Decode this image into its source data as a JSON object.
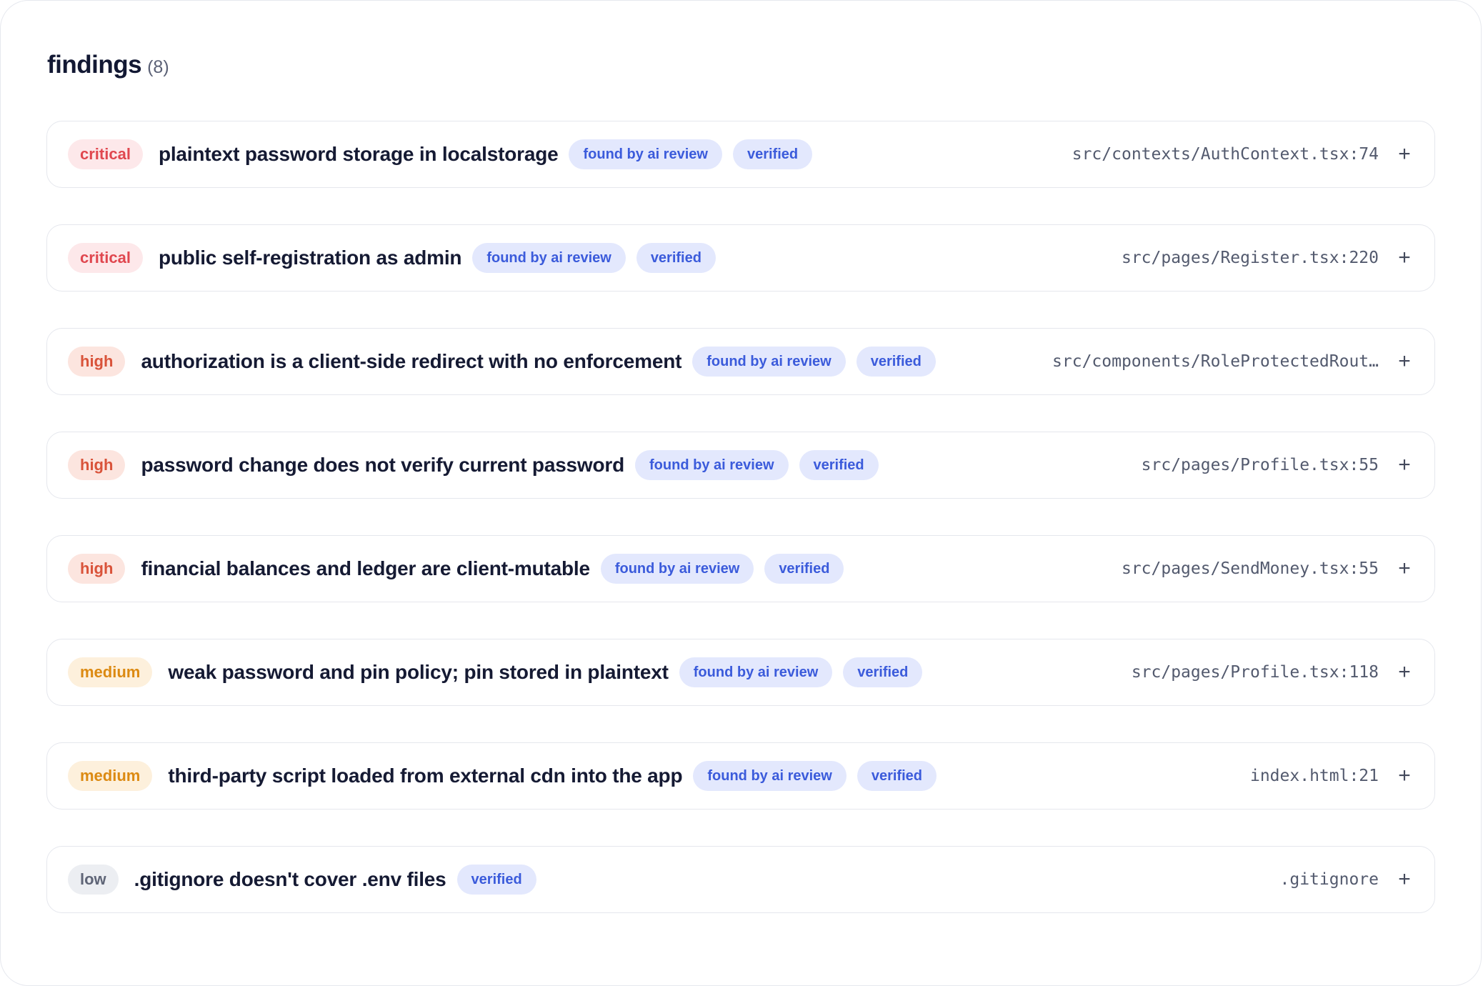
{
  "header": {
    "title": "findings",
    "count": "(8)"
  },
  "labels": {
    "found_by": "found by ai review",
    "verified": "verified"
  },
  "colors": {
    "critical": "#e0474f",
    "high": "#d9533a",
    "medium": "#dc8a12",
    "low": "#5f6577",
    "tag": "#3b5bdb"
  },
  "findings": [
    {
      "severity": "critical",
      "title": "plaintext password storage in localstorage",
      "found_by_ai": true,
      "verified": true,
      "location": "src/contexts/AuthContext.tsx:74",
      "expand_icon": "plus-icon"
    },
    {
      "severity": "critical",
      "title": "public self-registration as admin",
      "found_by_ai": true,
      "verified": true,
      "location": "src/pages/Register.tsx:220",
      "expand_icon": "plus-icon"
    },
    {
      "severity": "high",
      "title": "authorization is a client-side redirect with no enforcement",
      "found_by_ai": true,
      "verified": true,
      "location": "src/components/RoleProtectedRout…",
      "expand_icon": "plus-icon"
    },
    {
      "severity": "high",
      "title": "password change does not verify current password",
      "found_by_ai": true,
      "verified": true,
      "location": "src/pages/Profile.tsx:55",
      "expand_icon": "plus-icon"
    },
    {
      "severity": "high",
      "title": "financial balances and ledger are client-mutable",
      "found_by_ai": true,
      "verified": true,
      "location": "src/pages/SendMoney.tsx:55",
      "expand_icon": "plus-icon"
    },
    {
      "severity": "medium",
      "title": "weak password and pin policy; pin stored in plaintext",
      "found_by_ai": true,
      "verified": true,
      "location": "src/pages/Profile.tsx:118",
      "expand_icon": "plus-icon"
    },
    {
      "severity": "medium",
      "title": "third-party script loaded from external cdn into the app",
      "found_by_ai": true,
      "verified": true,
      "location": "index.html:21",
      "expand_icon": "plus-icon"
    },
    {
      "severity": "low",
      "title": ".gitignore doesn't cover .env files",
      "found_by_ai": false,
      "verified": true,
      "location": ".gitignore",
      "expand_icon": "plus-icon"
    }
  ]
}
